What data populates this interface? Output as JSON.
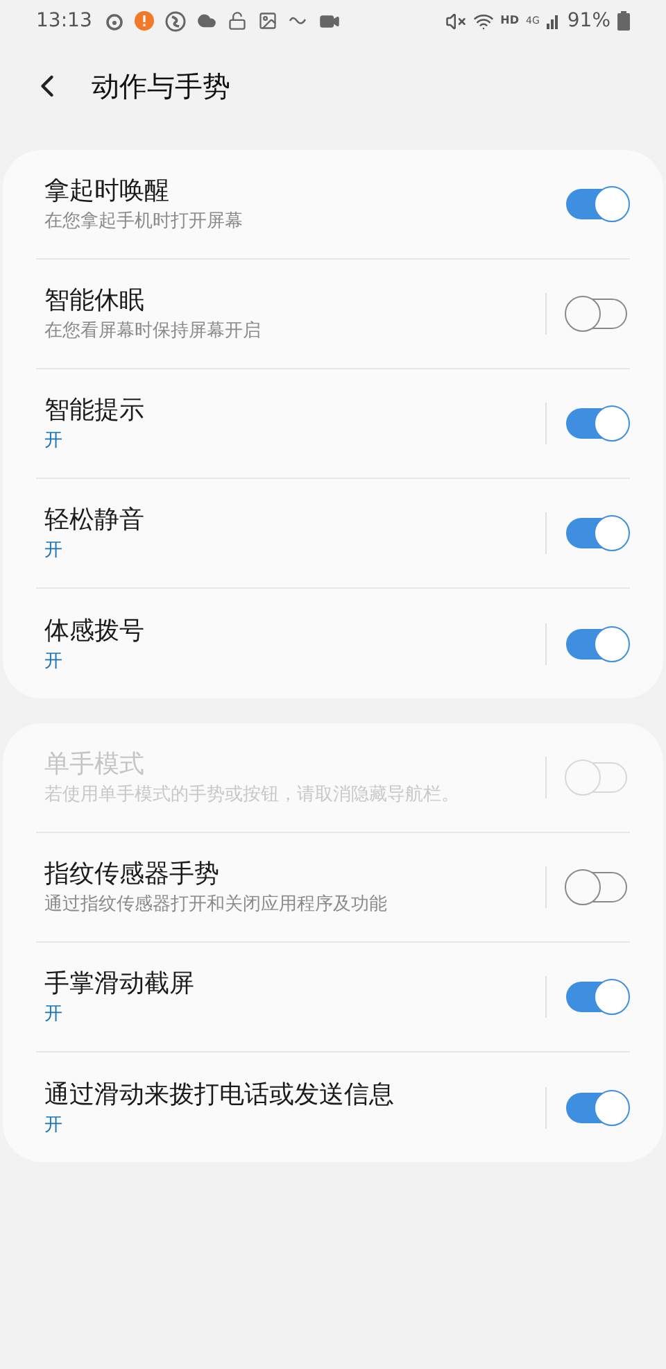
{
  "status_bar": {
    "time": "13:13",
    "network": "HD",
    "cell": "4G",
    "battery": "91%"
  },
  "header": {
    "title": "动作与手势"
  },
  "groups": [
    {
      "items": [
        {
          "title": "拿起时唤醒",
          "subtitle": "在您拿起手机时打开屏幕",
          "kind": "description",
          "on": true,
          "disabled": false,
          "has_page": false
        },
        {
          "title": "智能休眠",
          "subtitle": "在您看屏幕时保持屏幕开启",
          "kind": "description",
          "on": false,
          "disabled": false,
          "has_page": true
        },
        {
          "title": "智能提示",
          "subtitle": "开",
          "kind": "status",
          "on": true,
          "disabled": false,
          "has_page": true
        },
        {
          "title": "轻松静音",
          "subtitle": "开",
          "kind": "status",
          "on": true,
          "disabled": false,
          "has_page": true
        },
        {
          "title": "体感拨号",
          "subtitle": "开",
          "kind": "status",
          "on": true,
          "disabled": false,
          "has_page": true
        }
      ]
    },
    {
      "items": [
        {
          "title": "单手模式",
          "subtitle": "若使用单手模式的手势或按钮，请取消隐藏导航栏。",
          "kind": "description",
          "on": false,
          "disabled": true,
          "has_page": true
        },
        {
          "title": "指纹传感器手势",
          "subtitle": "通过指纹传感器打开和关闭应用程序及功能",
          "kind": "description",
          "on": false,
          "disabled": false,
          "has_page": true
        },
        {
          "title": "手掌滑动截屏",
          "subtitle": "开",
          "kind": "status",
          "on": true,
          "disabled": false,
          "has_page": true
        },
        {
          "title": "通过滑动来拨打电话或发送信息",
          "subtitle": "开",
          "kind": "status",
          "on": true,
          "disabled": false,
          "has_page": true
        }
      ]
    }
  ]
}
